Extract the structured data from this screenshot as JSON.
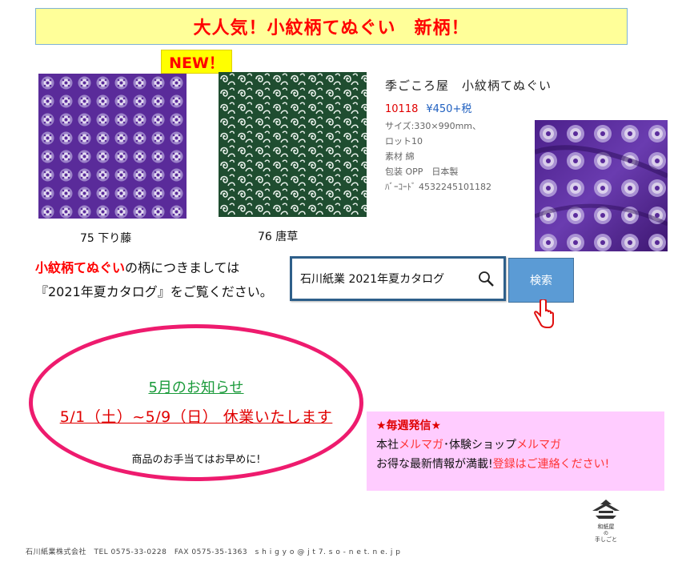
{
  "banner": {
    "text": "大人気！小紋柄てぬぐい　新柄！"
  },
  "new_badge": {
    "text": "NEW！"
  },
  "products": [
    {
      "caption": "75 下り藤",
      "pattern_color": "#5a2b9a"
    },
    {
      "caption": "76 唐草",
      "pattern_color": "#1f4d30"
    }
  ],
  "product_info": {
    "name": "季ごころ屋　小紋柄てぬぐい",
    "code": "10118",
    "price": "¥450+税",
    "spec_lines": [
      "サイズ:330×990mm、",
      "ロット10",
      "素材 綿",
      "包装 OPP　日本製",
      "ﾊﾞｰｺｰﾄﾞ 4532245101182"
    ]
  },
  "catalog_notice": {
    "highlight": "小紋柄てぬぐい",
    "line1_rest": "の柄につきましては",
    "line2": "『2021年夏カタログ』をご覧ください。"
  },
  "search": {
    "query": "石川紙業 2021年夏カタログ",
    "button_label": "検索"
  },
  "may_notice": {
    "title": "5月のお知らせ",
    "dates": "5/1（土）~5/9（日） 休業いたします",
    "note": "商品のお手当てはお早めに!"
  },
  "mailmag": {
    "heading": "★毎週発信★",
    "line1_a": "本社",
    "line1_b": "メルマガ",
    "line1_c": "･体験ショップ",
    "line1_d": "メルマガ",
    "line2_a": "お得な最新情報が満載!",
    "line2_b": "登録はご連絡ください!"
  },
  "footer": {
    "text": "石川紙業株式会社　TEL 0575-33-0228　FAX 0575-35-1363　s h i g y o @ j t 7. s o - n e t. n e. j p"
  },
  "logo": {
    "line1": "和紙屋",
    "line2": "の",
    "line3": "手しごと"
  }
}
